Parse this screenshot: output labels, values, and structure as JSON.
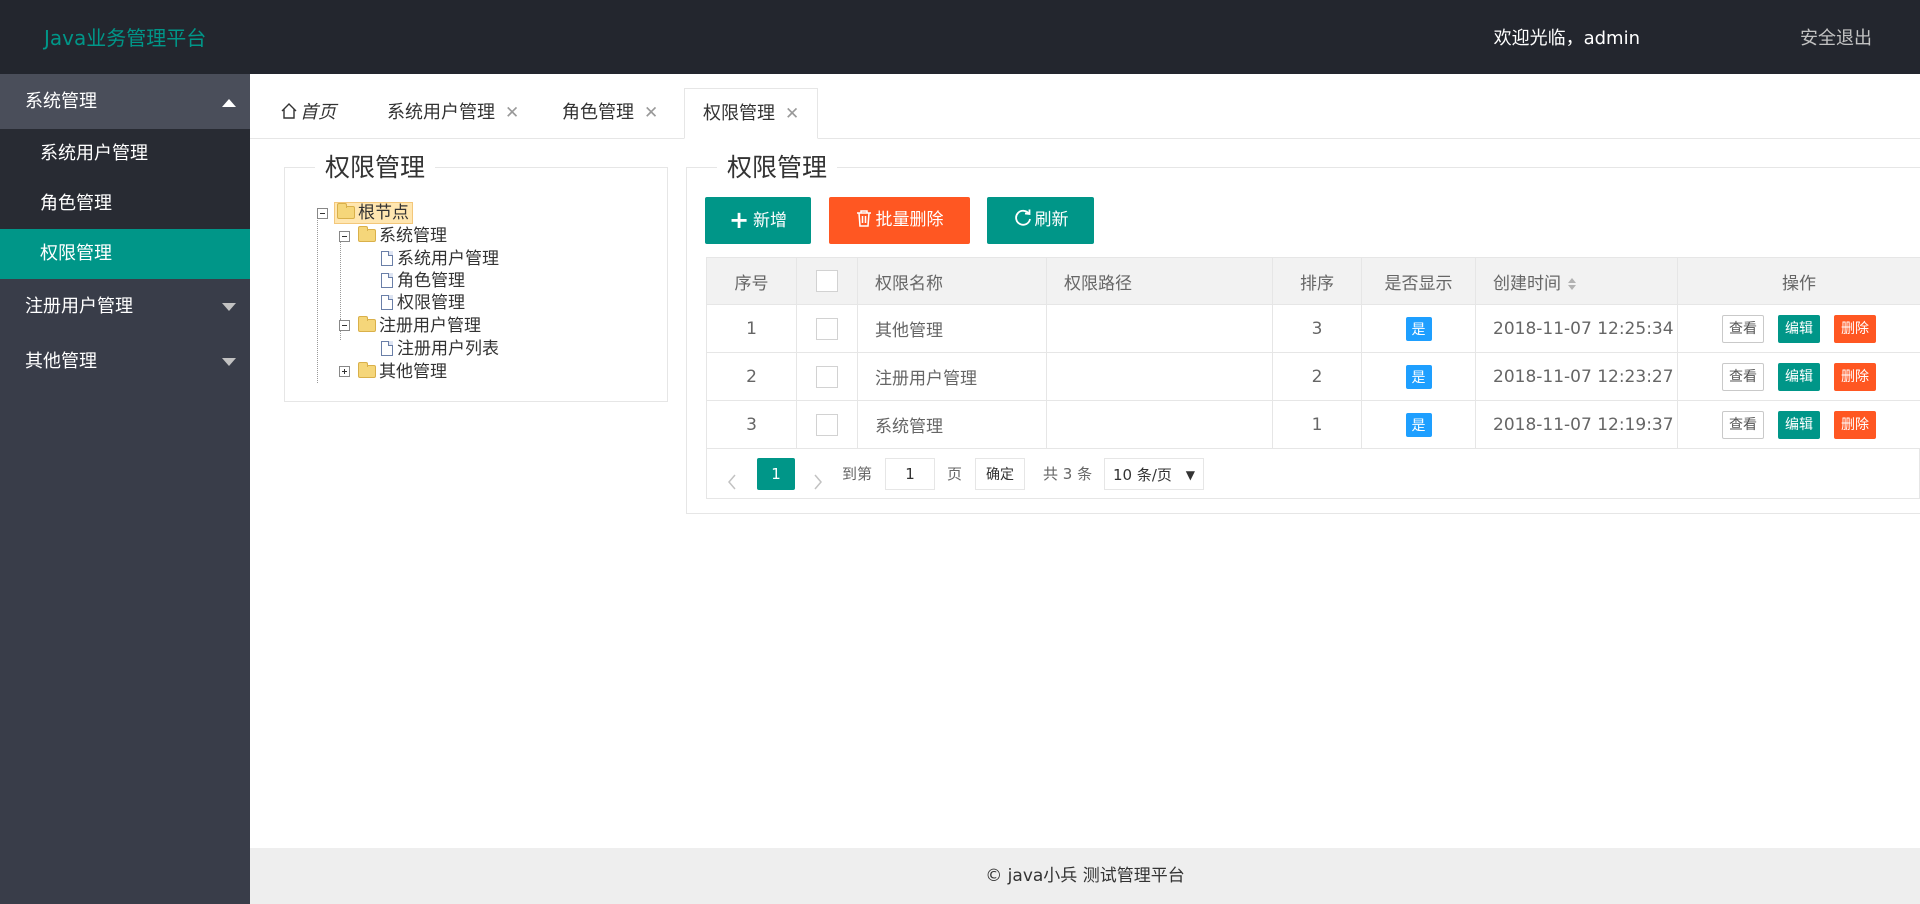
{
  "app": {
    "title": "Java业务管理平台",
    "welcome": "欢迎光临，admin",
    "logout": "安全退出"
  },
  "sidebar": {
    "groups": [
      {
        "label": "系统管理",
        "expanded": true,
        "items": [
          "系统用户管理",
          "角色管理",
          "权限管理"
        ],
        "active": "权限管理"
      },
      {
        "label": "注册用户管理",
        "expanded": false
      },
      {
        "label": "其他管理",
        "expanded": false
      }
    ]
  },
  "tabs": {
    "home": "首页",
    "items": [
      "系统用户管理",
      "角色管理",
      "权限管理"
    ],
    "active": "权限管理",
    "close_glyph": "✕"
  },
  "tree_panel": {
    "title": "权限管理",
    "nodes": {
      "root": "根节点",
      "sys": "系统管理",
      "sys_user": "系统用户管理",
      "role": "角色管理",
      "perm": "权限管理",
      "reg": "注册用户管理",
      "reg_list": "注册用户列表",
      "other": "其他管理"
    }
  },
  "main_panel": {
    "title": "权限管理",
    "buttons": {
      "add": "新增",
      "batch_delete": "批量删除",
      "refresh": "刷新"
    }
  },
  "table": {
    "headers": {
      "index": "序号",
      "name": "权限名称",
      "path": "权限路径",
      "order": "排序",
      "visible": "是否显示",
      "created": "创建时间",
      "ops": "操作"
    },
    "rows": [
      {
        "index": "1",
        "name": "其他管理",
        "path": "",
        "order": "3",
        "visible": "是",
        "created": "2018-11-07 12:25:34"
      },
      {
        "index": "2",
        "name": "注册用户管理",
        "path": "",
        "order": "2",
        "visible": "是",
        "created": "2018-11-07 12:23:27"
      },
      {
        "index": "3",
        "name": "系统管理",
        "path": "",
        "order": "1",
        "visible": "是",
        "created": "2018-11-07 12:19:37"
      }
    ],
    "ops": {
      "view": "查看",
      "edit": "编辑",
      "delete": "删除"
    }
  },
  "pagination": {
    "current": "1",
    "goto_label": "到第",
    "page_value": "1",
    "page_unit": "页",
    "confirm": "确定",
    "total": "共 3 条",
    "page_size": "10 条/页"
  },
  "footer": {
    "text": "© java小兵 测试管理平台"
  },
  "colors": {
    "accent": "#009688",
    "danger": "#ff5722",
    "info": "#1e9fff",
    "header_bg": "#23262e",
    "sidebar_bg": "#393d49"
  }
}
